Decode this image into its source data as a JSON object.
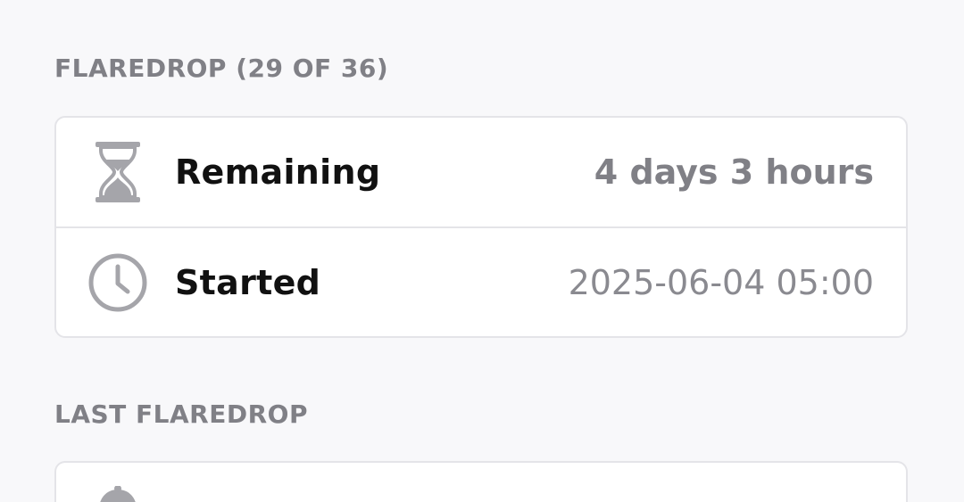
{
  "current": {
    "title": "FLAREDROP (29 OF 36)",
    "rows": [
      {
        "icon": "hourglass-icon",
        "label": "Remaining",
        "value": "4 days 3 hours"
      },
      {
        "icon": "clock-icon",
        "label": "Started",
        "value": "2025-06-04  05:00"
      }
    ]
  },
  "last": {
    "title": "LAST FLAREDROP",
    "rows": [
      {
        "icon": "bell-icon"
      }
    ]
  },
  "colors": {
    "background": "#f8f8fa",
    "card": "#ffffff",
    "border": "#e4e4e8",
    "muted_text": "#808086",
    "icon": "#a5a5aa"
  }
}
